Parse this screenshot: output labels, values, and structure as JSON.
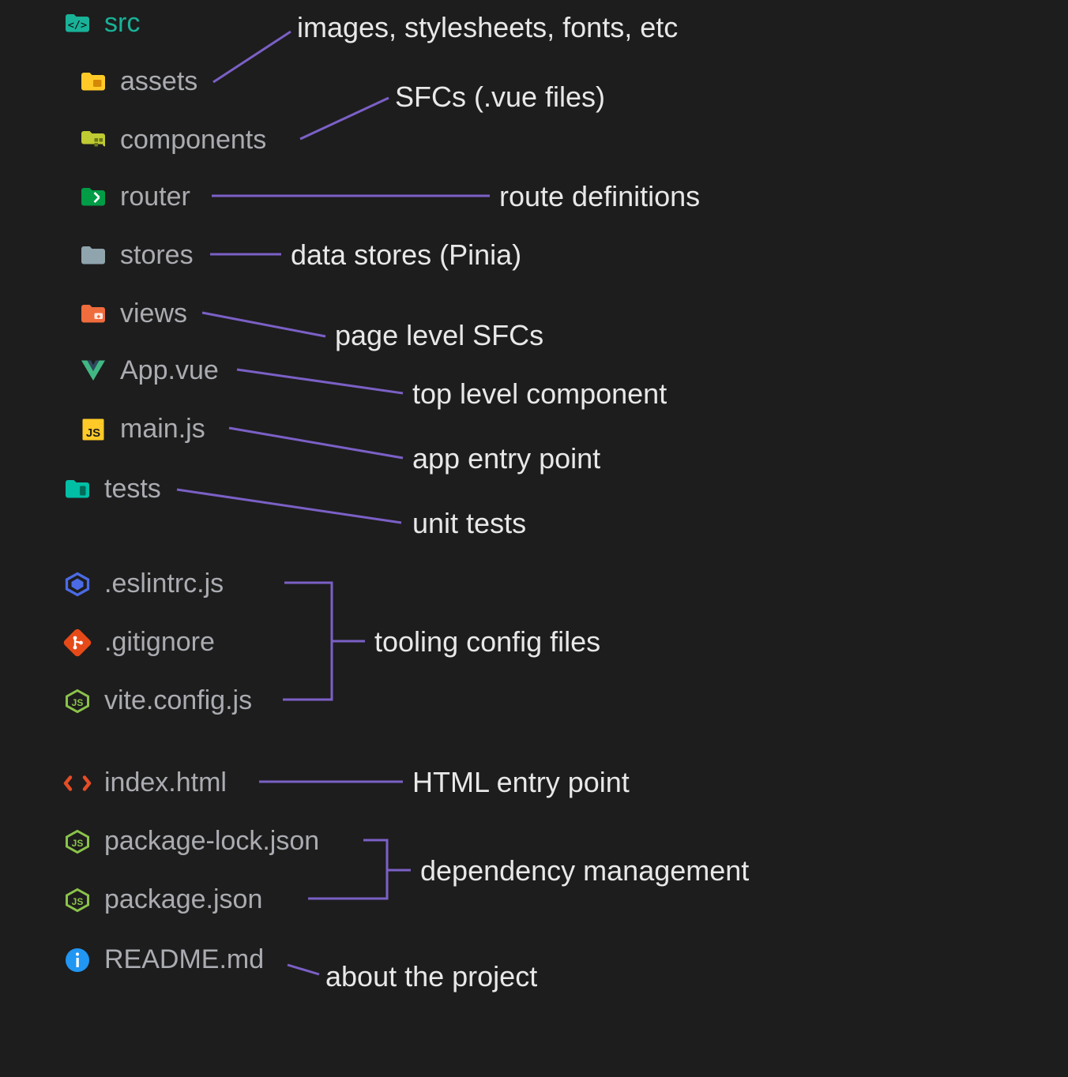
{
  "tree": {
    "root": {
      "label": "src"
    },
    "assets": {
      "label": "assets"
    },
    "components": {
      "label": "components"
    },
    "router": {
      "label": "router"
    },
    "stores": {
      "label": "stores"
    },
    "views": {
      "label": "views"
    },
    "appvue": {
      "label": "App.vue"
    },
    "mainjs": {
      "label": "main.js"
    },
    "tests": {
      "label": "tests"
    },
    "eslintrc": {
      "label": ".eslintrc.js"
    },
    "gitignore": {
      "label": ".gitignore"
    },
    "viteconfig": {
      "label": "vite.config.js"
    },
    "indexhtml": {
      "label": "index.html"
    },
    "pkglock": {
      "label": "package-lock.json"
    },
    "pkgjson": {
      "label": "package.json"
    },
    "readme": {
      "label": "README.md"
    }
  },
  "annotations": {
    "assets": "images, stylesheets, fonts, etc",
    "components": "SFCs (.vue files)",
    "router": "route definitions",
    "stores": "data stores (Pinia)",
    "views": "page level SFCs",
    "appvue": "top level component",
    "mainjs": "app entry point",
    "tests": "unit tests",
    "tooling": "tooling config files",
    "indexhtml": "HTML entry point",
    "dependency": "dependency management",
    "readme": "about the project"
  },
  "colors": {
    "bg": "#1d1d1d",
    "textMuted": "#aaacb1",
    "textBright": "#e8e8e8",
    "connector": "#7b60c6",
    "teal": "#19b298",
    "yellow": "#ffca28",
    "lime": "#c0ca33",
    "green": "#009c46",
    "gray": "#90a4ae",
    "orange": "#ef6c3d",
    "vueGreen": "#41b883",
    "jsYellow": "#ffca28",
    "eslintBlue": "#4b6be5",
    "gitOrange": "#e64a19",
    "nodeGreen": "#8bc34a",
    "htmlOrange": "#e44d26",
    "infoBlue": "#2196f3"
  }
}
